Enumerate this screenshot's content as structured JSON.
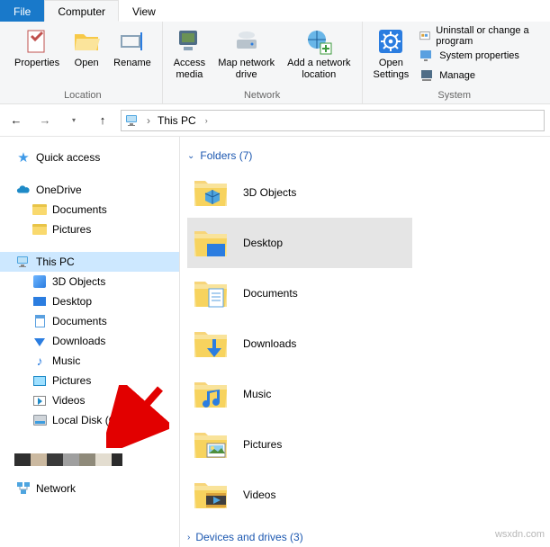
{
  "tabs": {
    "file": "File",
    "computer": "Computer",
    "view": "View"
  },
  "ribbon": {
    "location": {
      "label": "Location",
      "properties": "Properties",
      "open": "Open",
      "rename": "Rename"
    },
    "network": {
      "label": "Network",
      "access_media": "Access\nmedia",
      "map_drive": "Map network\ndrive",
      "add_location": "Add a network\nlocation"
    },
    "system": {
      "label": "System",
      "open_settings": "Open\nSettings",
      "uninstall": "Uninstall or change a program",
      "sys_props": "System properties",
      "manage": "Manage"
    }
  },
  "address": {
    "root": "This PC"
  },
  "tree": {
    "quick": "Quick access",
    "onedrive": "OneDrive",
    "od_docs": "Documents",
    "od_pics": "Pictures",
    "thispc": "This PC",
    "t3d": "3D Objects",
    "tdesk": "Desktop",
    "tdocs": "Documents",
    "tdl": "Downloads",
    "tmusic": "Music",
    "tpics": "Pictures",
    "tvids": "Videos",
    "tdisk": "Local Disk (C:)",
    "network": "Network"
  },
  "content": {
    "folders_hdr": "Folders (7)",
    "devices_hdr": "Devices and drives (3)",
    "items": [
      "3D Objects",
      "Desktop",
      "Documents",
      "Downloads",
      "Music",
      "Pictures",
      "Videos"
    ]
  },
  "watermark": "wsxdn.com"
}
